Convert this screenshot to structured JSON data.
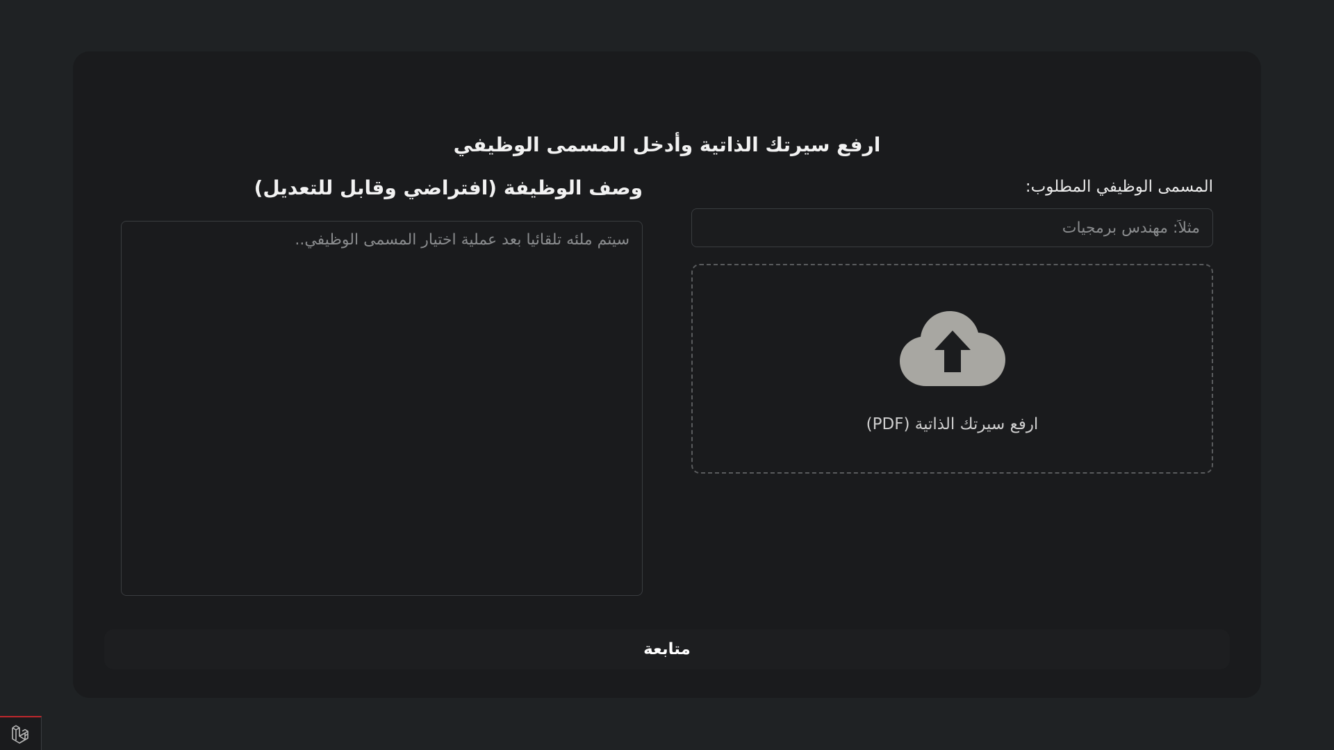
{
  "page": {
    "title": "ارفع سيرتك الذاتية وأدخل المسمى الوظيفي"
  },
  "job_title": {
    "label": "المسمى الوظيفي المطلوب:",
    "placeholder": "مثلاً: مهندس برمجيات",
    "value": ""
  },
  "upload": {
    "icon": "cloud-upload-icon",
    "label": "ارفع سيرتك الذاتية (PDF)"
  },
  "job_description": {
    "title": "وصف الوظيفة (افتراضي وقابل للتعديل)",
    "placeholder": "سيتم ملئه تلقائيا بعد عملية اختيار المسمى الوظيفي..",
    "value": ""
  },
  "actions": {
    "continue_label": "متابعة"
  },
  "colors": {
    "background": "#1f2224",
    "card": "#1a1b1d",
    "accent_badge": "#c0282d"
  },
  "corner_badge": {
    "icon": "laravel-logo-icon"
  }
}
